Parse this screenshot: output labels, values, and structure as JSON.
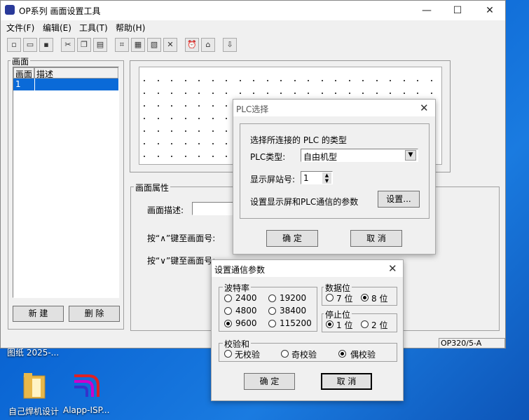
{
  "desktop": {
    "icon1_label": "自己焊机设计",
    "icon2_label": "Alapp-ISP...",
    "partial_label": "图纸 2025-..."
  },
  "window": {
    "title": "OP系列 画面设置工具",
    "minimize": "—",
    "maximize": "☐",
    "close": "✕"
  },
  "menu": [
    "文件(F)",
    "编辑(E)",
    "工具(T)",
    "帮助(H)"
  ],
  "toolbar": [
    "new-file-icon",
    "open-folder-icon",
    "save-icon",
    "cut-icon",
    "copy-icon",
    "paste-icon",
    "tool-icon-1",
    "tool-icon-2",
    "tool-icon-3",
    "tool-icon-4",
    "alarm-icon",
    "home-icon",
    "transfer-icon"
  ],
  "screen_panel": {
    "group_title": "画面",
    "col1": "画面",
    "col2": "描述",
    "rows": [
      {
        "num": "1",
        "desc": ""
      }
    ],
    "new_button": "新 建",
    "delete_button": "删 除"
  },
  "props": {
    "group_title": "画面属性",
    "desc_label": "画面描述:",
    "up_label": "按“∧”键至画面号:",
    "down_label": "按“∨”键至画面号:"
  },
  "status": {
    "model": "OP320/5-A"
  },
  "plc_dialog": {
    "title": "PLC选择",
    "close": "✕",
    "heading": "选择所连接的 PLC 的类型",
    "type_label": "PLC类型:",
    "type_value": "自由机型",
    "station_label": "显示屏站号:",
    "station_value": "1",
    "comm_label": "设置显示屏和PLC通信的参数",
    "settings_button": "设置...",
    "ok_button": "确 定",
    "cancel_button": "取 消"
  },
  "comm_dialog": {
    "title": "设置通信参数",
    "close": "✕",
    "baud_title": "波特率",
    "baud_options": [
      "2400",
      "19200",
      "4800",
      "38400",
      "9600",
      "115200"
    ],
    "baud_selected": "9600",
    "data_title": "数据位",
    "data_options": [
      "7 位",
      "8 位"
    ],
    "data_selected": "8 位",
    "stop_title": "停止位",
    "stop_options": [
      "1 位",
      "2 位"
    ],
    "stop_selected": "1 位",
    "parity_title": "校验和",
    "parity_options": [
      "无校验",
      "奇校验",
      "偶校验"
    ],
    "parity_selected": "偶校验",
    "ok_button": "确 定",
    "cancel_button": "取 消"
  }
}
